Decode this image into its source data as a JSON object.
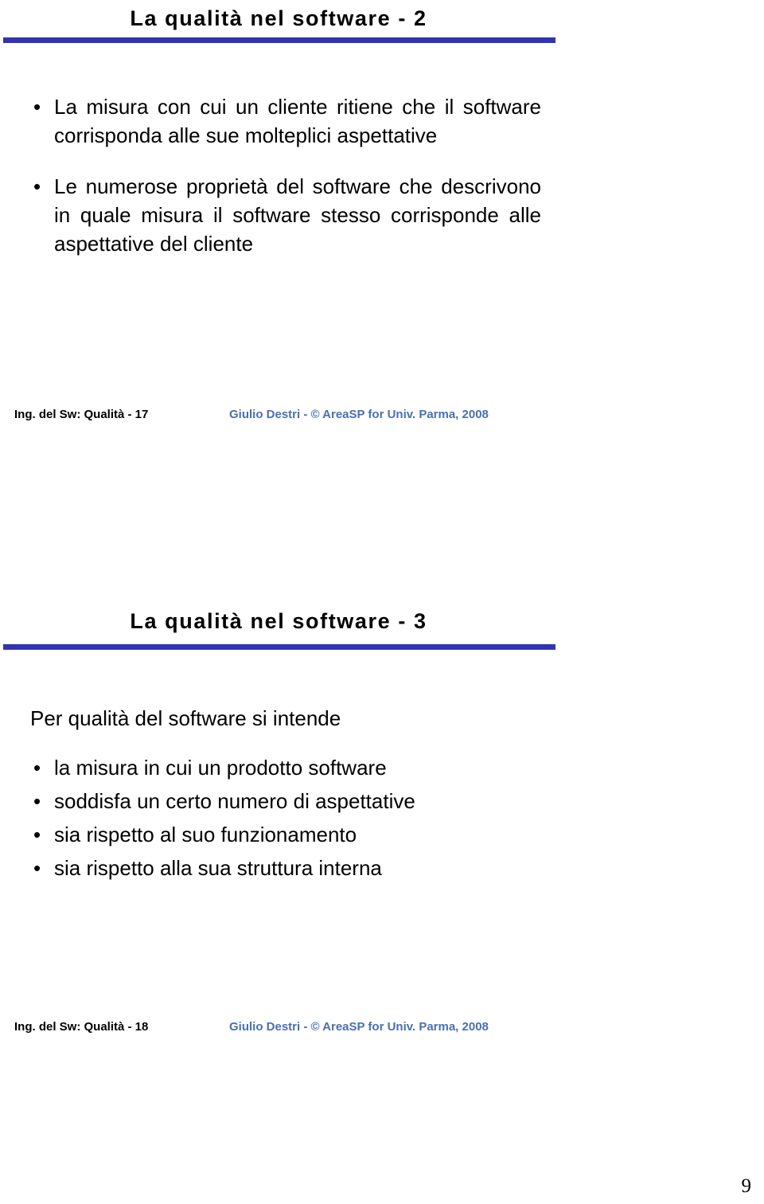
{
  "document": {
    "page_number": "9"
  },
  "slides": [
    {
      "id": "slide-1",
      "title": "La qualità nel software - 2",
      "bullets": [
        "La misura con cui un cliente ritiene che il software corrisponda alle sue molteplici aspettative",
        "Le numerose proprietà del software che descrivono in quale misura il software stesso corrisponde alle aspettative del cliente"
      ],
      "bullet_marker": "•",
      "footer": {
        "left": "Ing. del Sw: Qualità - 17",
        "right": "Giulio Destri - © AreaSP for Univ. Parma,  2008"
      }
    },
    {
      "id": "slide-2",
      "title": "La qualità nel software - 3",
      "intro": "Per qualità del software si intende",
      "bullets": [
        "la misura in cui un prodotto software",
        "soddisfa un certo numero di aspettative",
        "sia rispetto al suo funzionamento",
        "sia rispetto alla sua struttura interna"
      ],
      "bullet_marker": "•",
      "footer": {
        "left": "Ing. del Sw: Qualità - 18",
        "right": "Giulio Destri - © AreaSP for Univ. Parma,  2008"
      }
    }
  ],
  "colors": {
    "title_rule": "#3333b5",
    "footer_right_text": "#4a6fb0",
    "body_text": "#000000",
    "background": "#ffffff"
  }
}
